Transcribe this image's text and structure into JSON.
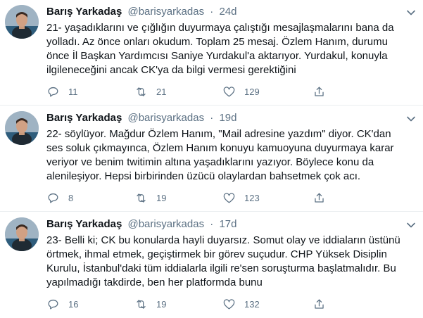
{
  "colors": {
    "text_primary": "#0f1419",
    "text_secondary": "#5b7083",
    "divider": "#ebeef0"
  },
  "icons": {
    "reply": "reply-icon",
    "retweet": "retweet-icon",
    "like": "like-icon",
    "share": "share-icon",
    "more": "chevron-down-icon"
  },
  "tweets": [
    {
      "name": "Barış Yarkadaş",
      "handle": "@barisyarkadas",
      "separator": "·",
      "time": "24d",
      "text": "21- yaşadıklarını ve çığlığın duyurmaya çalıştığı mesajlaşmalarını bana da yolladı. Az önce onları okudum. Toplam 25 mesaj. Özlem Hanım, durumu önce İl Başkan Yardımcısı Saniye Yurdakul'a aktarıyor. Yurdakul, konuyla ilgileneceğini ancak CK'ya da bilgi vermesi gerektiğini",
      "replies": "11",
      "retweets": "21",
      "likes": "129"
    },
    {
      "name": "Barış Yarkadaş",
      "handle": "@barisyarkadas",
      "separator": "·",
      "time": "19d",
      "text": "22- söylüyor. Mağdur Özlem Hanım, \"Mail adresine yazdım\" diyor. CK'dan ses soluk çıkmayınca, Özlem Hanım konuyu kamuoyuna duyurmaya karar veriyor ve benim twitimin altına yaşadıklarını yazıyor. Böylece konu da alenileşiyor. Hepsi birbirinden üzücü olaylardan bahsetmek çok acı.",
      "replies": "8",
      "retweets": "19",
      "likes": "123"
    },
    {
      "name": "Barış Yarkadaş",
      "handle": "@barisyarkadas",
      "separator": "·",
      "time": "17d",
      "text": "23- Belli ki; CK bu konularda hayli duyarsız. Somut olay ve iddiaların üstünü örtmek, ihmal etmek, geçiştirmek bir görev suçudur. CHP Yüksek Disiplin Kurulu, İstanbul'daki tüm iddialarla ilgili re'sen soruşturma başlatmalıdır. Bu yapılmadığı takdirde, ben her platformda bunu",
      "replies": "16",
      "retweets": "19",
      "likes": "132"
    }
  ]
}
